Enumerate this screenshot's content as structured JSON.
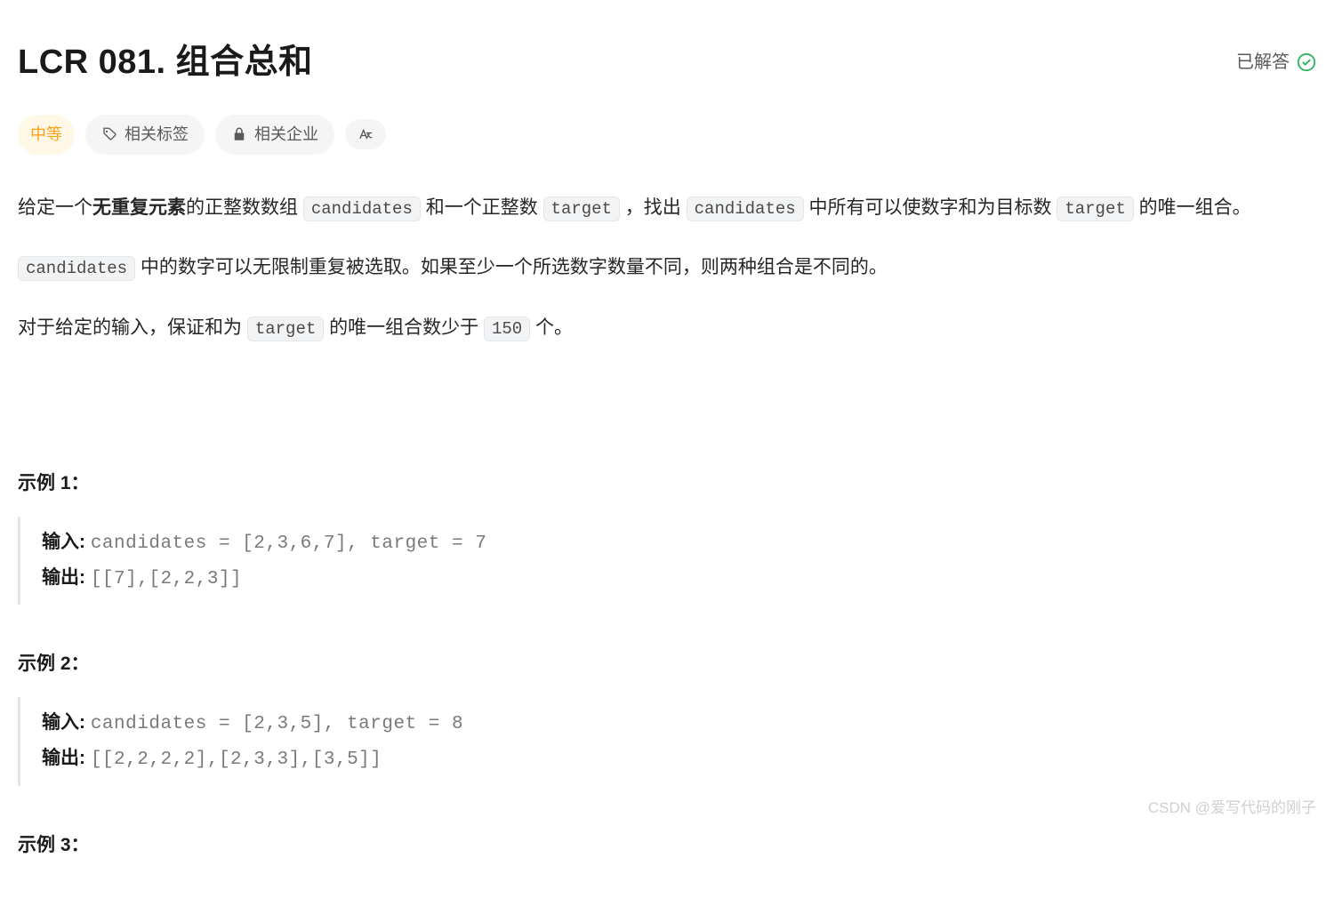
{
  "title": "LCR 081. 组合总和",
  "solved_label": "已解答",
  "meta": {
    "difficulty": "中等",
    "tags_label": "相关标签",
    "companies_label": "相关企业"
  },
  "description": {
    "p1_prefix": "给定一个",
    "p1_bold": "无重复元素",
    "p1_seg1": "的正整数数组 ",
    "p1_code1": "candidates",
    "p1_seg2": " 和一个正整数 ",
    "p1_code2": "target",
    "p1_seg3": " ，找出 ",
    "p1_code3": "candidates",
    "p1_seg4": " 中所有可以使数字和为目标数 ",
    "p1_code4": "target",
    "p1_seg5": " 的唯一组合。",
    "p2_code1": "candidates",
    "p2_seg1": " 中的数字可以无限制重复被选取。如果至少一个所选数字数量不同，则两种组合是不同的。",
    "p3_seg1": "对于给定的输入，保证和为 ",
    "p3_code1": "target",
    "p3_seg2": " 的唯一组合数少于 ",
    "p3_code2": "150",
    "p3_seg3": " 个。"
  },
  "examples": [
    {
      "label": "示例 1：",
      "input_label": "输入: ",
      "input_value": "candidates = [2,3,6,7], target = 7",
      "output_label": "输出: ",
      "output_value": "[[7],[2,2,3]]"
    },
    {
      "label": "示例 2：",
      "input_label": "输入: ",
      "input_value": "candidates = [2,3,5], target = 8",
      "output_label": "输出: ",
      "output_value": "[[2,2,2,2],[2,3,3],[3,5]]"
    },
    {
      "label": "示例 3：",
      "input_label": "",
      "input_value": "",
      "output_label": "",
      "output_value": ""
    }
  ],
  "watermark": "CSDN @爱写代码的刚子"
}
